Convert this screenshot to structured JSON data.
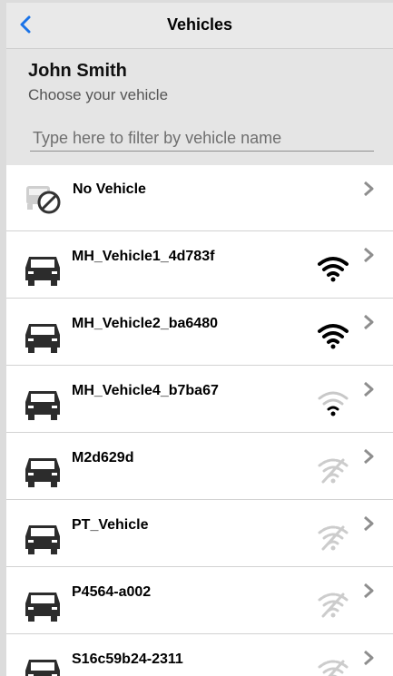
{
  "nav": {
    "title": "Vehicles",
    "back_icon": "chevron-left-icon",
    "accent": "#1a73e8"
  },
  "header": {
    "user_name": "John Smith",
    "subtitle": "Choose your vehicle",
    "filter_placeholder": "Type here to filter by vehicle name",
    "filter_value": ""
  },
  "vehicles": [
    {
      "label": "No Vehicle",
      "icon": "no-vehicle-icon",
      "signal": "none"
    },
    {
      "label": "MH_Vehicle1_4d783f",
      "icon": "truck-icon",
      "signal": "strong"
    },
    {
      "label": "MH_Vehicle2_ba6480",
      "icon": "truck-icon",
      "signal": "strong"
    },
    {
      "label": "MH_Vehicle4_b7ba67",
      "icon": "truck-icon",
      "signal": "weak"
    },
    {
      "label": "M2d629d",
      "icon": "truck-icon",
      "signal": "off"
    },
    {
      "label": "PT_Vehicle",
      "icon": "truck-icon",
      "signal": "off"
    },
    {
      "label": "P4564-a002",
      "icon": "truck-icon",
      "signal": "off"
    },
    {
      "label": "S16c59b24-2311",
      "icon": "truck-icon",
      "signal": "off"
    }
  ],
  "colors": {
    "signal_strong": "#000000",
    "signal_weak": "#bdbdbd",
    "signal_off": "#c8c8c8",
    "chevron": "#8e8e8e"
  }
}
